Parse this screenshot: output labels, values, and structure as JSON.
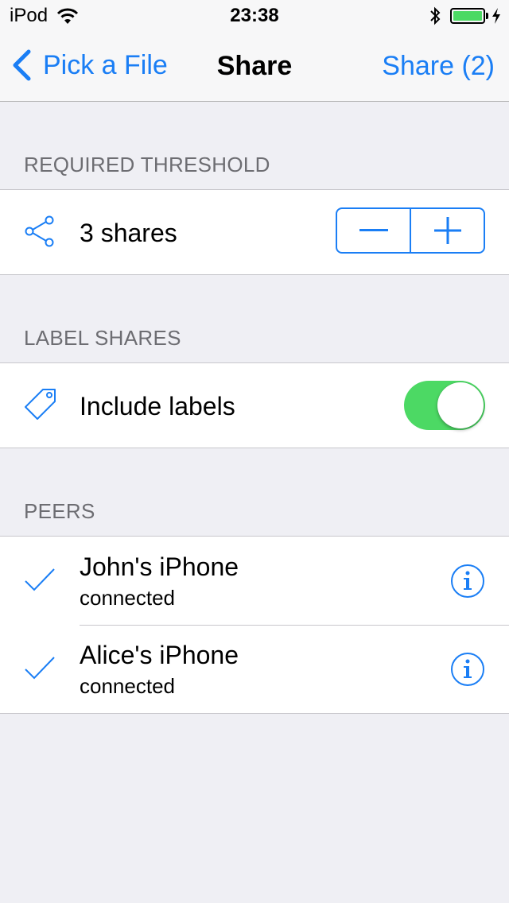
{
  "status_bar": {
    "carrier": "iPod",
    "time": "23:38",
    "icons": [
      "wifi-icon",
      "bluetooth-icon",
      "battery-icon",
      "charging-icon"
    ],
    "battery_color": "#4cd964"
  },
  "nav": {
    "back_label": "Pick a File",
    "title": "Share",
    "right_label": "Share (2)",
    "tint": "#1a7ef5"
  },
  "threshold": {
    "header": "REQUIRED THRESHOLD",
    "label": "3 shares",
    "icon": "share-icon",
    "stepper": {
      "minus": "−",
      "plus": "+"
    }
  },
  "labels": {
    "header": "LABEL SHARES",
    "label": "Include labels",
    "icon": "tag-icon",
    "toggle_on": true
  },
  "peers": {
    "header": "PEERS",
    "items": [
      {
        "name": "John's iPhone",
        "status": "connected"
      },
      {
        "name": "Alice's iPhone",
        "status": "connected"
      }
    ]
  }
}
